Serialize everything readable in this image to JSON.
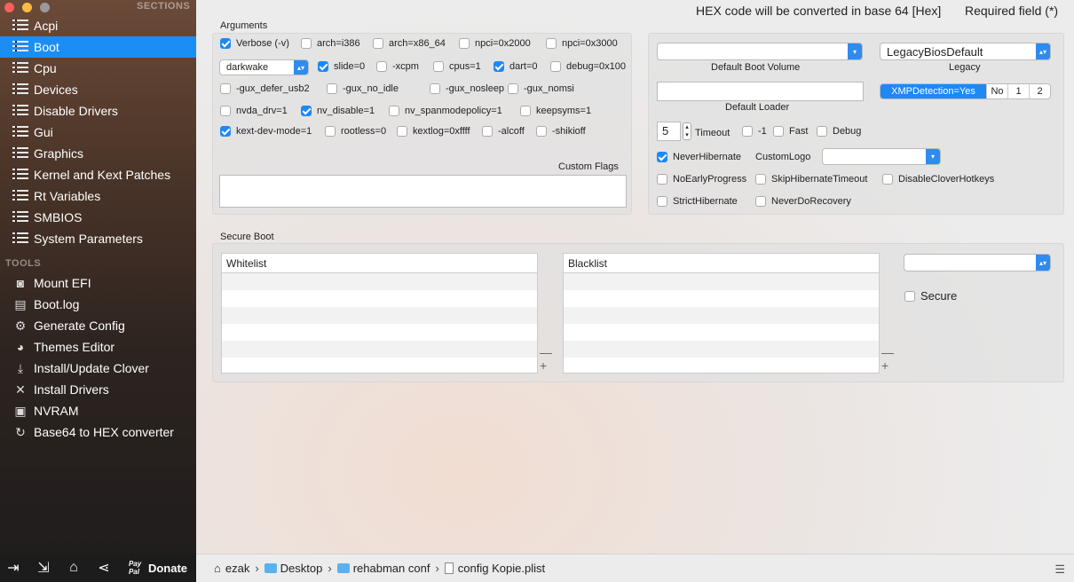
{
  "sidebar": {
    "sections_header": "SECTIONS",
    "tools_header": "TOOLS",
    "sections": [
      {
        "label": "Acpi",
        "selected": false
      },
      {
        "label": "Boot",
        "selected": true
      },
      {
        "label": "Cpu",
        "selected": false
      },
      {
        "label": "Devices",
        "selected": false
      },
      {
        "label": "Disable Drivers",
        "selected": false
      },
      {
        "label": "Gui",
        "selected": false
      },
      {
        "label": "Graphics",
        "selected": false
      },
      {
        "label": "Kernel and Kext Patches",
        "selected": false
      },
      {
        "label": "Rt Variables",
        "selected": false
      },
      {
        "label": "SMBIOS",
        "selected": false
      },
      {
        "label": "System Parameters",
        "selected": false
      }
    ],
    "tools": [
      {
        "label": "Mount EFI",
        "icon": "disk-icon"
      },
      {
        "label": "Boot.log",
        "icon": "log-icon"
      },
      {
        "label": "Generate Config",
        "icon": "gear-icon"
      },
      {
        "label": "Themes Editor",
        "icon": "palette-icon"
      },
      {
        "label": "Install/Update Clover",
        "icon": "download-icon"
      },
      {
        "label": "Install Drivers",
        "icon": "tools-icon"
      },
      {
        "label": "NVRAM",
        "icon": "chip-icon"
      },
      {
        "label": "Base64 to HEX converter",
        "icon": "refresh-icon"
      }
    ],
    "bottom": {
      "donate_label": "Donate",
      "paypal_label": "Pay Pal"
    }
  },
  "header": {
    "hex_note": "HEX code will be converted in base 64 [Hex]",
    "required_note": "Required field (*)"
  },
  "arguments": {
    "title": "Arguments",
    "darkwake_value": "darkwake",
    "custom_flags_label": "Custom Flags",
    "custom_flags_value": "",
    "checkboxes": [
      {
        "label": "Verbose (-v)",
        "checked": true
      },
      {
        "label": "arch=i386",
        "checked": false
      },
      {
        "label": "arch=x86_64",
        "checked": false
      },
      {
        "label": "npci=0x2000",
        "checked": false
      },
      {
        "label": "npci=0x3000",
        "checked": false
      },
      {
        "label": "slide=0",
        "checked": true
      },
      {
        "label": "-xcpm",
        "checked": false
      },
      {
        "label": "cpus=1",
        "checked": false
      },
      {
        "label": "dart=0",
        "checked": true
      },
      {
        "label": "debug=0x100",
        "checked": false
      },
      {
        "label": "-gux_defer_usb2",
        "checked": false
      },
      {
        "label": "-gux_no_idle",
        "checked": false
      },
      {
        "label": "-gux_nosleep",
        "checked": false
      },
      {
        "label": "-gux_nomsi",
        "checked": false
      },
      {
        "label": "nvda_drv=1",
        "checked": false
      },
      {
        "label": "nv_disable=1",
        "checked": true
      },
      {
        "label": "nv_spanmodepolicy=1",
        "checked": false
      },
      {
        "label": "keepsyms=1",
        "checked": false
      },
      {
        "label": "kext-dev-mode=1",
        "checked": true
      },
      {
        "label": "rootless=0",
        "checked": false
      },
      {
        "label": "kextlog=0xffff",
        "checked": false
      },
      {
        "label": "-alcoff",
        "checked": false
      },
      {
        "label": "-shikioff",
        "checked": false
      }
    ]
  },
  "boot": {
    "default_boot_volume_label": "Default Boot Volume",
    "default_boot_volume_value": "",
    "legacy_label": "Legacy",
    "legacy_value": "LegacyBiosDefault",
    "default_loader_label": "Default Loader",
    "default_loader_value": "",
    "xmp_options": [
      "XMPDetection=Yes",
      "No",
      "1",
      "2"
    ],
    "timeout_value": "5",
    "timeout_label": "Timeout",
    "custom_logo_label": "CustomLogo",
    "custom_logo_value": "",
    "checkboxes": [
      {
        "label": "-1",
        "checked": false
      },
      {
        "label": "Fast",
        "checked": false
      },
      {
        "label": "Debug",
        "checked": false
      },
      {
        "label": "NeverHibernate",
        "checked": true
      },
      {
        "label": "NoEarlyProgress",
        "checked": false
      },
      {
        "label": "SkipHibernateTimeout",
        "checked": false
      },
      {
        "label": "DisableCloverHotkeys",
        "checked": false
      },
      {
        "label": "StrictHibernate",
        "checked": false
      },
      {
        "label": "NeverDoRecovery",
        "checked": false
      }
    ]
  },
  "secure_boot": {
    "title": "Secure Boot",
    "whitelist_header": "Whitelist",
    "blacklist_header": "Blacklist",
    "policy_value": "",
    "secure_label": "Secure",
    "secure_checked": false
  },
  "pathbar": {
    "crumbs": [
      "ezak",
      "Desktop",
      "rehabman conf",
      "config Kopie.plist"
    ]
  }
}
